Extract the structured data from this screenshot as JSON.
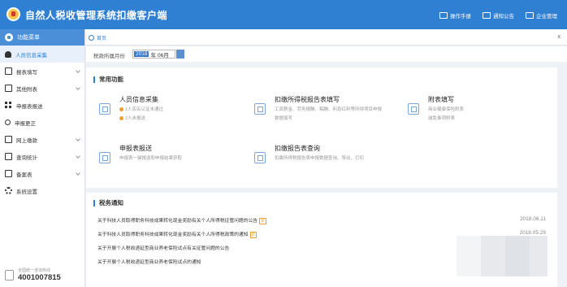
{
  "header": {
    "title": "自然人税收管理系统扣缴客户端",
    "links": [
      {
        "label": "操作手册",
        "icon": "manual-icon"
      },
      {
        "label": "通知公告",
        "icon": "mail-icon"
      },
      {
        "label": "企业管理",
        "icon": "building-icon"
      }
    ]
  },
  "sidebar": {
    "heading": "功能菜单",
    "items": [
      {
        "label": "人员信息采集",
        "icon": "person-icon"
      },
      {
        "label": "报表填写",
        "icon": "form-icon"
      },
      {
        "label": "其他附表",
        "icon": "table-icon"
      },
      {
        "label": "申报表报送",
        "icon": "grid-icon"
      },
      {
        "label": "申报更正",
        "icon": "search-icon"
      },
      {
        "label": "网上缴款",
        "icon": "payment-icon"
      },
      {
        "label": "查询统计",
        "icon": "stats-icon"
      },
      {
        "label": "备案表",
        "icon": "record-icon"
      },
      {
        "label": "系统设置",
        "icon": "gear-icon"
      }
    ],
    "hotline_label": "全国统一咨询热线",
    "hotline_number": "4001007815"
  },
  "tabbar": {
    "home_tab": "首页",
    "close": "x"
  },
  "period": {
    "label": "税款所属月份",
    "year": "2018",
    "year_suffix": "年",
    "month": "06月"
  },
  "common": {
    "title": "常用功能",
    "funcs": [
      {
        "name": "人员信息采集",
        "desc1": "1人实名认证未通过",
        "desc2": "2人未报送"
      },
      {
        "name": "扣缴所得税报告表填写",
        "desc1": "工资薪金、劳务报酬、稿酬、利息红利等所得项目申报",
        "desc2": "数据填写"
      },
      {
        "name": "附表填写",
        "desc1": "商业健康保险附表",
        "desc2": "减免事项附表"
      },
      {
        "name": "申报表报送",
        "desc1": "申报表一键报送和申报结果获取",
        "desc2": ""
      },
      {
        "name": "扣缴报告表查询",
        "desc1": "扣缴所得税报告表申报数据查询、导出、打印",
        "desc2": ""
      }
    ]
  },
  "notices": {
    "title": "税务通知",
    "badge": "新",
    "items": [
      {
        "text": "关于科技人员取得职务科技成果转化现金奖励有关个人所得税征管问题的公告",
        "date": "2018.06.11",
        "new": true
      },
      {
        "text": "关于科技人员取得职务科技成果转化现金奖励有关个人所得税政策的通知",
        "date": "2018.05.29",
        "new": true
      },
      {
        "text": "关于开展个人税收递延型商业养老保险试点有关征管问题的公告",
        "date": "",
        "new": false
      },
      {
        "text": "关于开展个人税收递延型商业养老保险试点的通知",
        "date": "",
        "new": false
      }
    ]
  },
  "colors": {
    "primary": "#2f7fd2",
    "accent": "#f0a030",
    "background": "#eef1f5"
  }
}
